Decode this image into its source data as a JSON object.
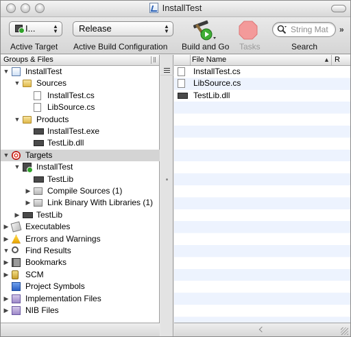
{
  "window": {
    "title": "InstallTest"
  },
  "toolbar": {
    "active_target_value": "I...",
    "active_target_label": "Active Target",
    "build_config_value": "Release",
    "build_config_label": "Active Build Configuration",
    "build_and_go_label": "Build and Go",
    "tasks_label": "Tasks",
    "search_placeholder": "String Mat",
    "search_label": "Search",
    "overflow_chevrons": "»"
  },
  "sidebar": {
    "header": "Groups & Files",
    "items": [
      {
        "label": "InstallTest",
        "icon": "project-icon",
        "disclosure": "open"
      },
      {
        "label": "Sources",
        "icon": "folder-icon",
        "disclosure": "open"
      },
      {
        "label": "InstallTest.cs",
        "icon": "document-icon",
        "disclosure": ""
      },
      {
        "label": "LibSource.cs",
        "icon": "document-icon",
        "disclosure": ""
      },
      {
        "label": "Products",
        "icon": "folder-icon",
        "disclosure": "open"
      },
      {
        "label": "InstallTest.exe",
        "icon": "executable-icon",
        "disclosure": ""
      },
      {
        "label": "TestLib.dll",
        "icon": "library-icon",
        "disclosure": ""
      },
      {
        "label": "Targets",
        "icon": "target-icon",
        "disclosure": "open",
        "selected": true
      },
      {
        "label": "InstallTest",
        "icon": "active-target-icon",
        "disclosure": "open"
      },
      {
        "label": "TestLib",
        "icon": "library-icon",
        "disclosure": ""
      },
      {
        "label": "Compile Sources (1)",
        "icon": "build-phase-icon",
        "disclosure": "closed"
      },
      {
        "label": "Link Binary With Libraries (1)",
        "icon": "build-phase-icon",
        "disclosure": "closed"
      },
      {
        "label": "TestLib",
        "icon": "library-icon",
        "disclosure": "closed"
      },
      {
        "label": "Executables",
        "icon": "executables-icon",
        "disclosure": "closed"
      },
      {
        "label": "Errors and Warnings",
        "icon": "warning-icon",
        "disclosure": "closed"
      },
      {
        "label": "Find Results",
        "icon": "find-icon",
        "disclosure": "open"
      },
      {
        "label": "Bookmarks",
        "icon": "bookmarks-icon",
        "disclosure": "closed"
      },
      {
        "label": "SCM",
        "icon": "scm-icon",
        "disclosure": "closed"
      },
      {
        "label": "Project Symbols",
        "icon": "symbols-icon",
        "disclosure": ""
      },
      {
        "label": "Implementation Files",
        "icon": "smart-group-icon",
        "disclosure": "closed"
      },
      {
        "label": "NIB Files",
        "icon": "smart-group-icon",
        "disclosure": "closed"
      }
    ]
  },
  "file_list": {
    "col_name": "File Name",
    "col_r": "R",
    "sort_indicator": "▲",
    "rows": [
      {
        "name": "InstallTest.cs",
        "icon": "document-icon"
      },
      {
        "name": "LibSource.cs",
        "icon": "document-icon"
      },
      {
        "name": "TestLib.dll",
        "icon": "library-icon"
      }
    ]
  }
}
